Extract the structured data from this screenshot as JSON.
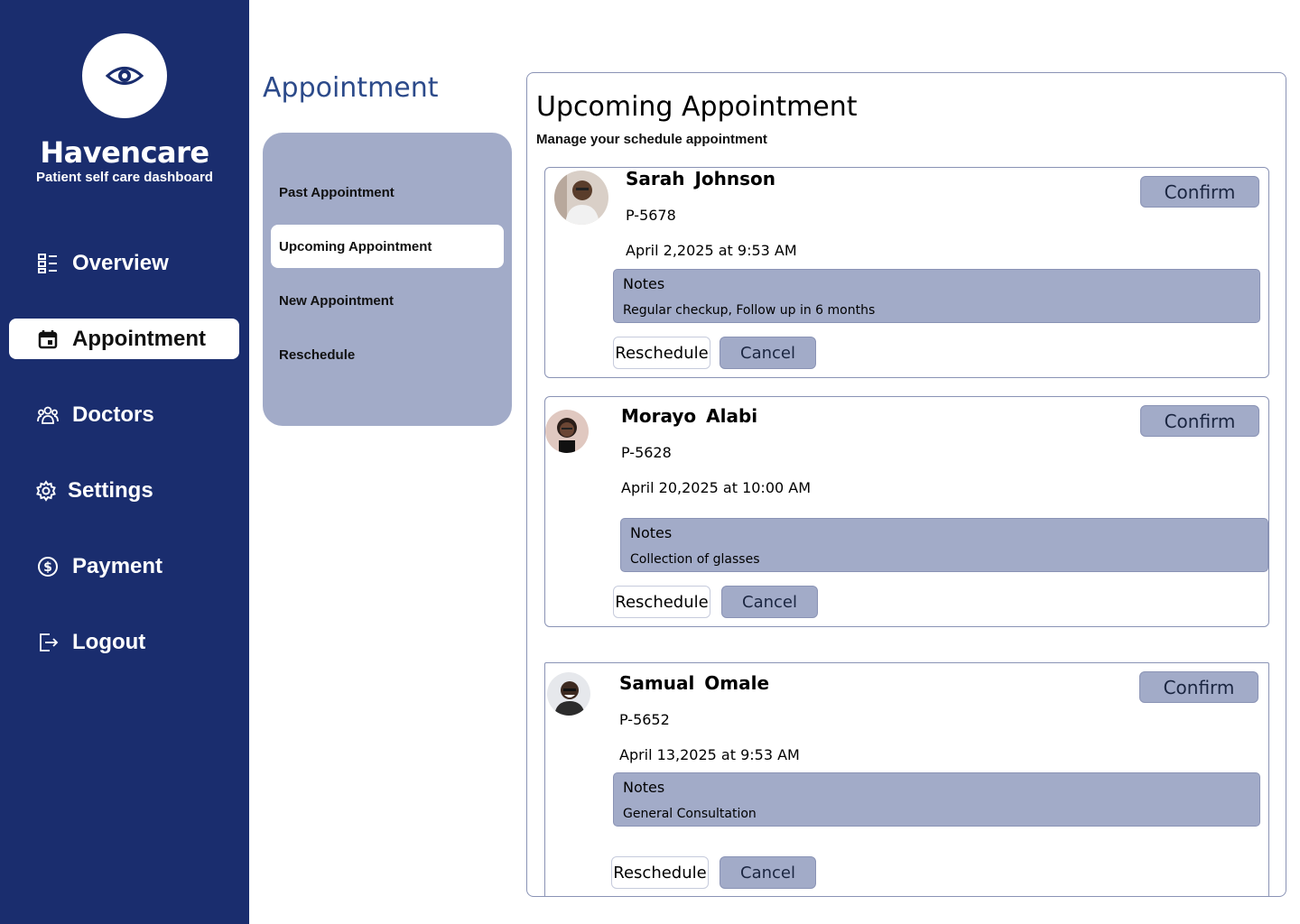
{
  "brand": {
    "title": "Havencare",
    "subtitle": "Patient self care dashboard",
    "logo_icon": "eye-icon"
  },
  "nav": [
    {
      "label": "Overview",
      "icon": "dashboard-icon"
    },
    {
      "label": "Appointment",
      "icon": "calendar-icon",
      "active": true
    },
    {
      "label": "Doctors",
      "icon": "doctors-group-icon"
    },
    {
      "label": "Settings",
      "icon": "gear-icon"
    },
    {
      "label": "Payment",
      "icon": "dollar-icon"
    },
    {
      "label": "Logout",
      "icon": "logout-icon"
    }
  ],
  "page_title": "Appointment",
  "submenu": [
    {
      "label": "Past Appointment"
    },
    {
      "label": "Upcoming Appointment",
      "active": true
    },
    {
      "label": "New Appointment"
    },
    {
      "label": "Reschedule"
    }
  ],
  "main": {
    "title": "Upcoming Appointment",
    "subtitle": "Manage your schedule appointment",
    "notes_label": "Notes",
    "confirm_label": "Confirm",
    "reschedule_label": "Reschedule",
    "cancel_label": "Cancel",
    "appointments": [
      {
        "name": "Sarah Johnson",
        "id": "P-5678",
        "datetime": "April 2,2025 at 9:53 AM",
        "notes": "Regular checkup, Follow up in 6 months"
      },
      {
        "name": "Morayo  Alabi",
        "id": "P-5628",
        "datetime": "April 20,2025 at 10:00 AM",
        "notes": "Collection of glasses"
      },
      {
        "name": "Samual  Omale",
        "id": "P-5652",
        "datetime": "April 13,2025 at 9:53 AM",
        "notes": "General Consultation"
      }
    ]
  },
  "colors": {
    "sidebar": "#1a2d6e",
    "accent": "#a2abc8",
    "title_blue": "#2c4a8a",
    "border": "#8a93b5"
  }
}
